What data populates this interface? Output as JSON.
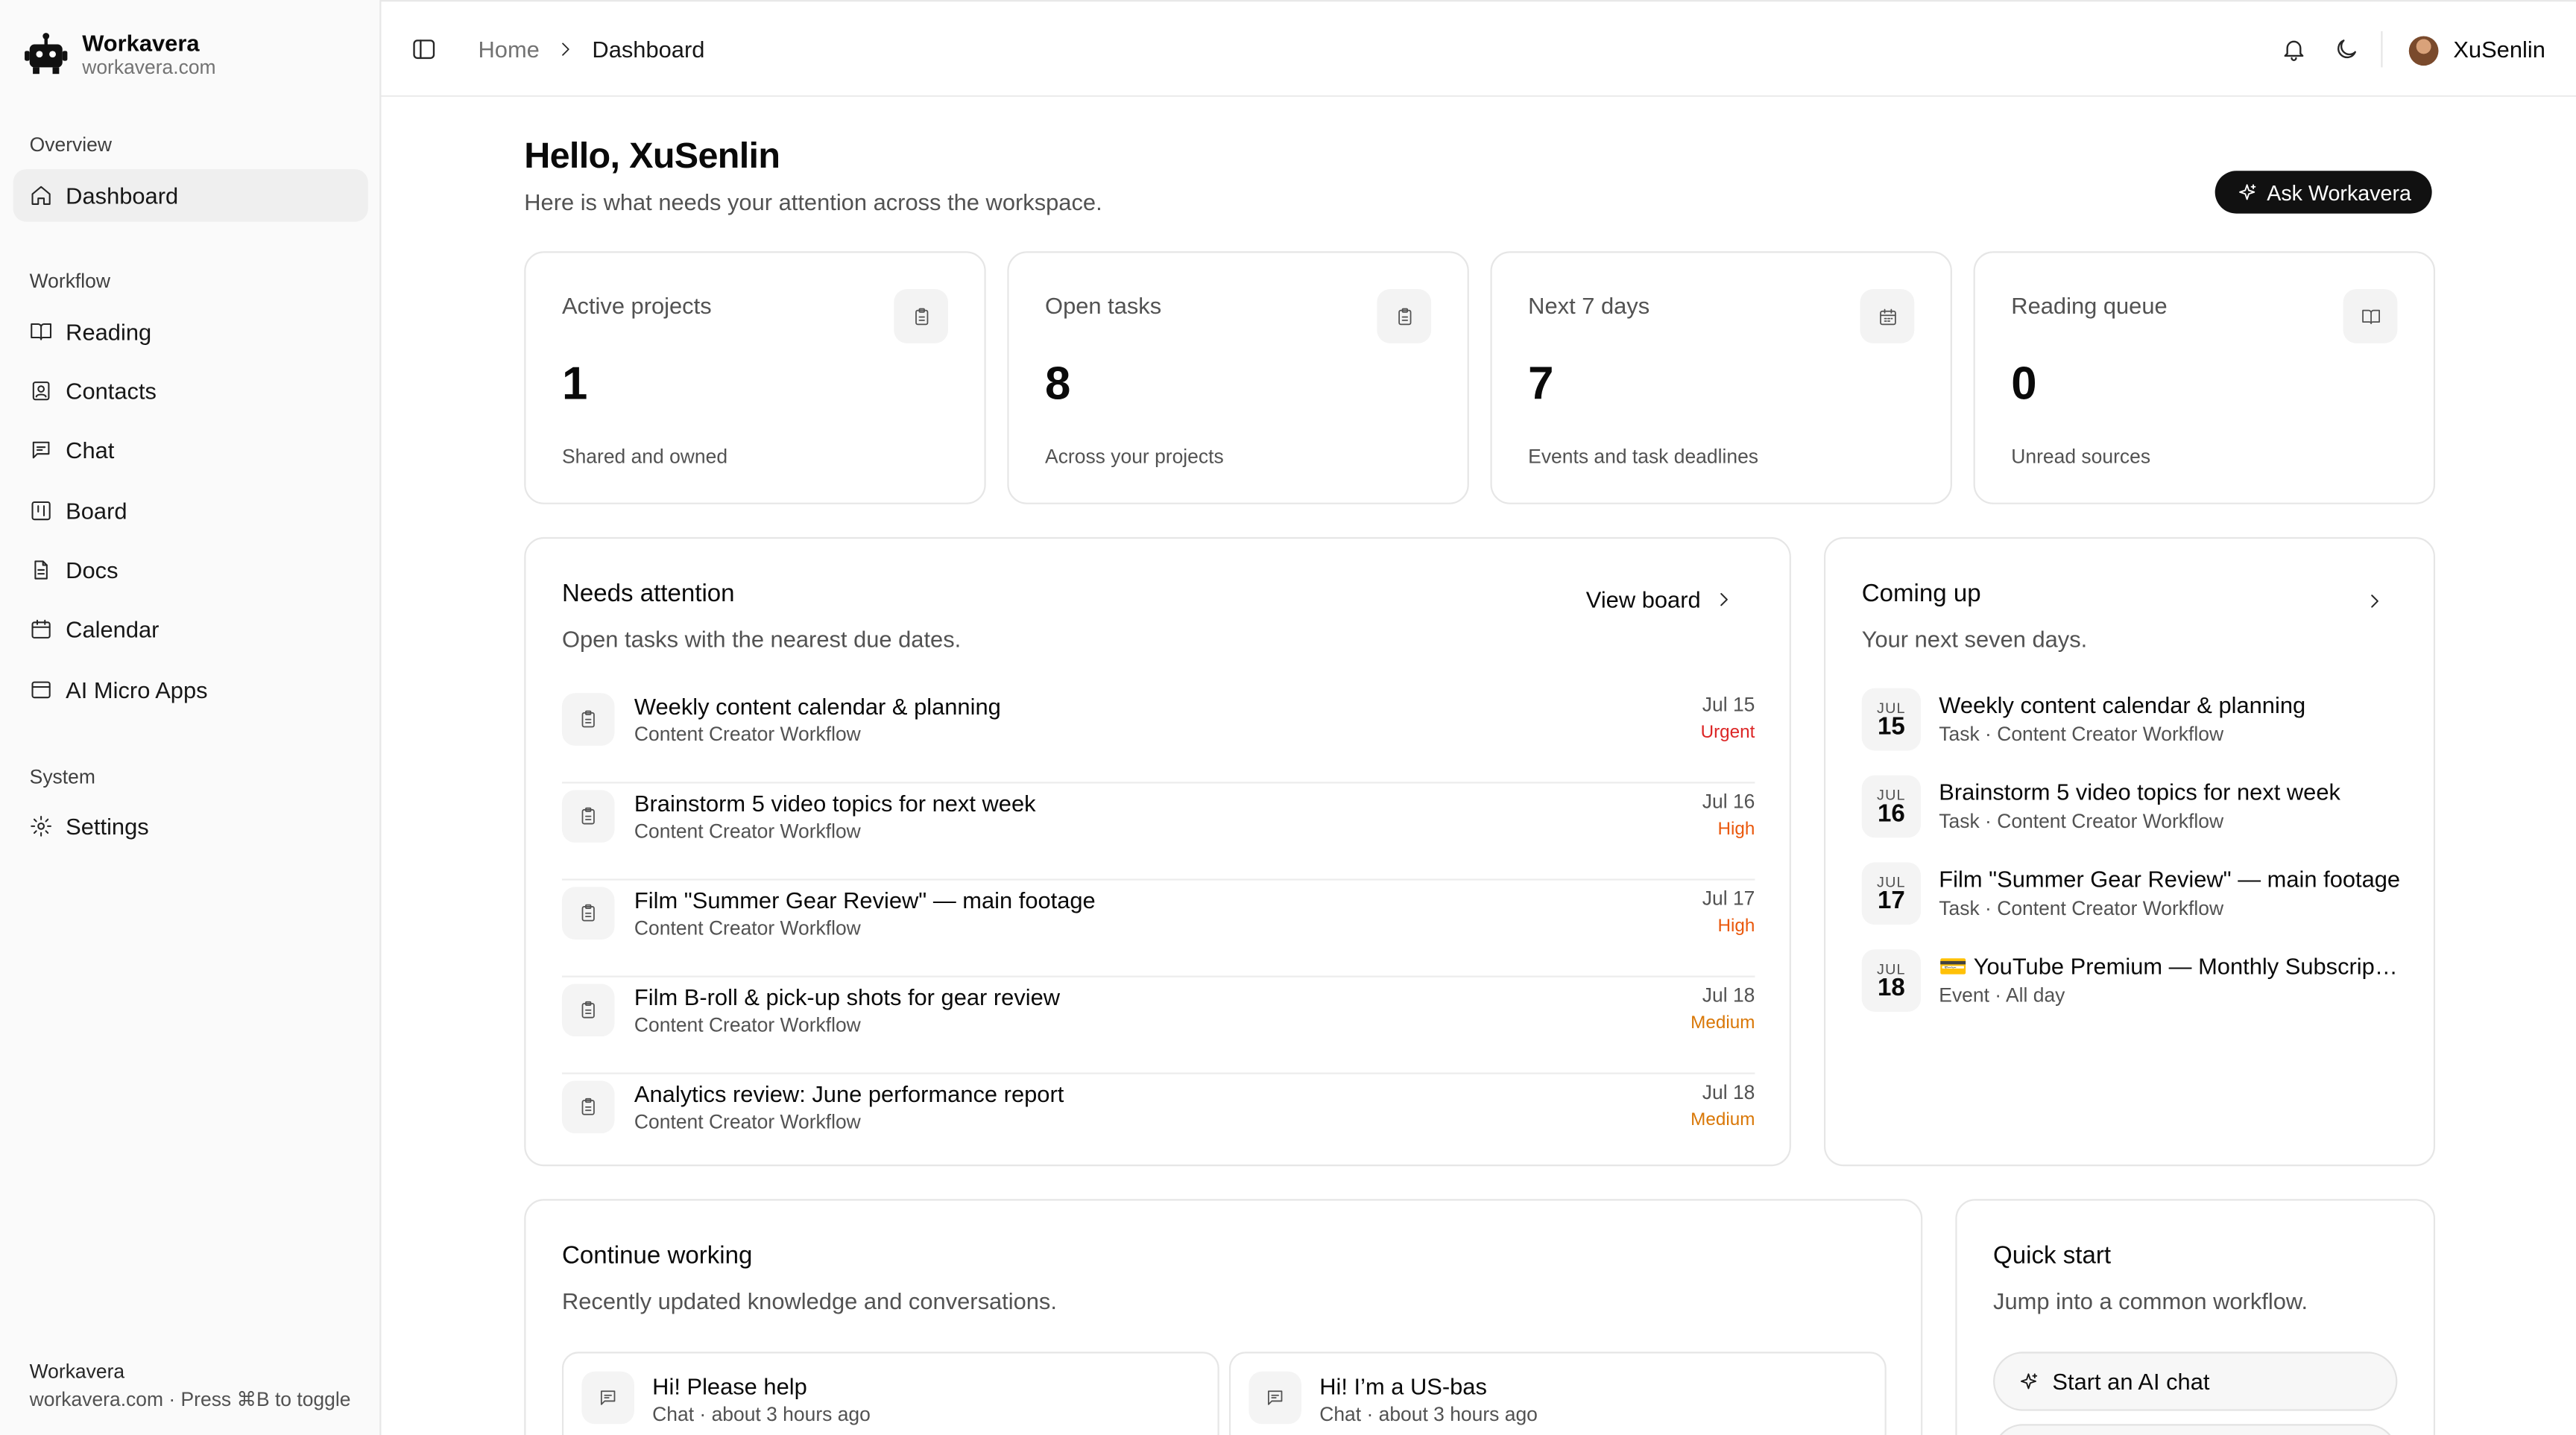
{
  "brand": {
    "name": "Workavera",
    "domain": "workavera.com"
  },
  "sidebar": {
    "groups": [
      {
        "label": "Overview",
        "items": [
          {
            "label": "Dashboard",
            "icon": "home-icon"
          }
        ]
      },
      {
        "label": "Workflow",
        "items": [
          {
            "label": "Reading",
            "icon": "book-icon"
          },
          {
            "label": "Contacts",
            "icon": "contacts-icon"
          },
          {
            "label": "Chat",
            "icon": "chat-icon"
          },
          {
            "label": "Board",
            "icon": "board-icon"
          },
          {
            "label": "Docs",
            "icon": "docs-icon"
          },
          {
            "label": "Calendar",
            "icon": "calendar-icon"
          },
          {
            "label": "AI Micro Apps",
            "icon": "app-window-icon"
          }
        ]
      },
      {
        "label": "System",
        "items": [
          {
            "label": "Settings",
            "icon": "gear-icon"
          }
        ]
      }
    ],
    "footer": {
      "title": "Workavera",
      "hint": "workavera.com · Press ⌘B to toggle"
    }
  },
  "header": {
    "breadcrumb": {
      "home": "Home",
      "current": "Dashboard"
    },
    "user": "XuSenlin"
  },
  "main": {
    "greeting": "Hello, XuSenlin",
    "subtitle": "Here is what needs your attention across the workspace.",
    "ask_button": "Ask Workavera",
    "stats": [
      {
        "label": "Active projects",
        "value": "1",
        "caption": "Shared and owned",
        "icon": "clipboard-icon"
      },
      {
        "label": "Open tasks",
        "value": "8",
        "caption": "Across your projects",
        "icon": "clipboard-icon"
      },
      {
        "label": "Next 7 days",
        "value": "7",
        "caption": "Events and task deadlines",
        "icon": "calendar-icon"
      },
      {
        "label": "Reading queue",
        "value": "0",
        "caption": "Unread sources",
        "icon": "book-icon"
      }
    ],
    "attention": {
      "title": "Needs attention",
      "subtitle": "Open tasks with the nearest due dates.",
      "view_board": "View board",
      "tasks": [
        {
          "title": "Weekly content calendar & planning",
          "project": "Content Creator Workflow",
          "date": "Jul 15",
          "priority": "Urgent"
        },
        {
          "title": "Brainstorm 5 video topics for next week",
          "project": "Content Creator Workflow",
          "date": "Jul 16",
          "priority": "High"
        },
        {
          "title": "Film \"Summer Gear Review\" — main footage",
          "project": "Content Creator Workflow",
          "date": "Jul 17",
          "priority": "High"
        },
        {
          "title": "Film B-roll & pick-up shots for gear review",
          "project": "Content Creator Workflow",
          "date": "Jul 18",
          "priority": "Medium"
        },
        {
          "title": "Analytics review: June performance report",
          "project": "Content Creator Workflow",
          "date": "Jul 18",
          "priority": "Medium"
        }
      ]
    },
    "coming_up": {
      "title": "Coming up",
      "subtitle": "Your next seven days.",
      "items": [
        {
          "month": "JUL",
          "day": "15",
          "title": "Weekly content calendar & planning",
          "meta": "Task · Content Creator Workflow"
        },
        {
          "month": "JUL",
          "day": "16",
          "title": "Brainstorm 5 video topics for next week",
          "meta": "Task · Content Creator Workflow"
        },
        {
          "month": "JUL",
          "day": "17",
          "title": "Film \"Summer Gear Review\" — main footage",
          "meta": "Task · Content Creator Workflow"
        },
        {
          "month": "JUL",
          "day": "18",
          "title": "💳 YouTube Premium — Monthly Subscription",
          "meta": "Event · All day"
        }
      ]
    },
    "continue": {
      "title": "Continue working",
      "subtitle": "Recently updated knowledge and conversations.",
      "items": [
        {
          "title": "Hi! Please help",
          "meta": "Chat · about 3 hours ago"
        },
        {
          "title": "Hi! I’m a US-bas",
          "meta": "Chat · about 3 hours ago"
        }
      ]
    },
    "quick_start": {
      "title": "Quick start",
      "subtitle": "Jump into a common workflow.",
      "primary": "Start an AI chat"
    }
  },
  "colors": {
    "urgent": "#dc2626",
    "high": "#ea580c",
    "medium": "#d97706",
    "accent": "#111111"
  }
}
